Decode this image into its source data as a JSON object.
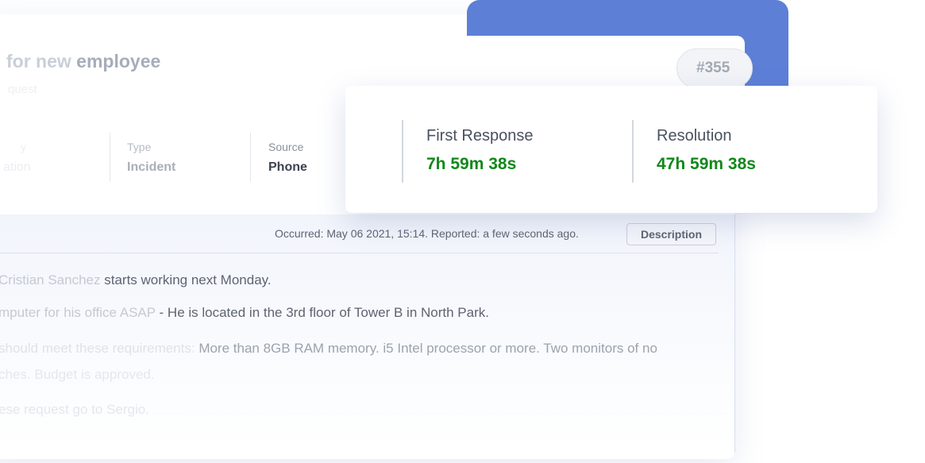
{
  "ticket": {
    "title_prefix": "for new",
    "title_main": "employee",
    "subtitle": "quest",
    "number": "#355"
  },
  "meta": {
    "first_label": "y",
    "first_value": "ation",
    "type_label": "Type",
    "type_value": "Incident",
    "source_label": "Source",
    "source_value": "Phone"
  },
  "sla": {
    "first_response_label": "First Response",
    "first_response_value": "7h 59m 38s",
    "resolution_label": "Resolution",
    "resolution_value": "47h 59m 38s",
    "value_color": "#11881a"
  },
  "occurrence": {
    "text": "Occurred: May 06 2021, 15:14. Reported: a few seconds ago.",
    "tab_label": "Description"
  },
  "description": {
    "line1_faint": "Cristian Sanchez",
    "line1_rest": " starts working next Monday.",
    "line2_faint": "mputer for his office ASAP",
    "line2_rest": " - He is located in the 3rd floor of Tower B in North Park.",
    "line3_faint": "should meet these requirements:",
    "line3_rest": " More than 8GB RAM memory. i5 Intel processor or more. Two monitors of no",
    "line4": "ches. Budget is approved.",
    "line5": "ese request go to Sergio."
  },
  "colors": {
    "accent_blue": "#5d7fd6",
    "success_green": "#11881a"
  }
}
